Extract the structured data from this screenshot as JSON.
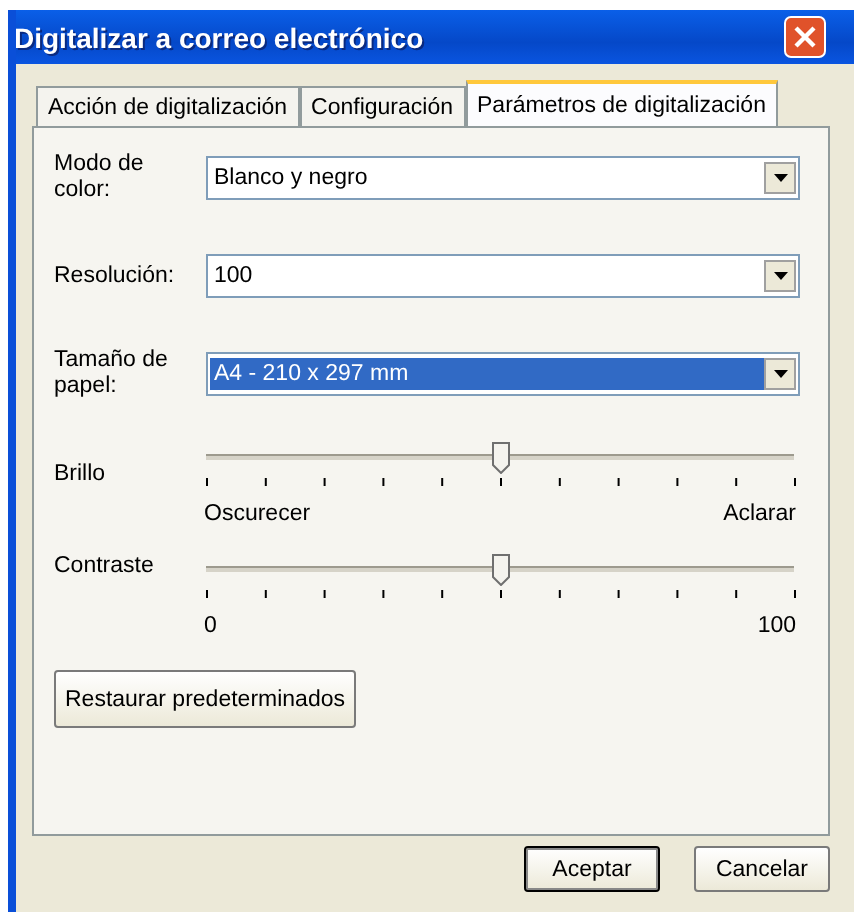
{
  "window": {
    "title": "Digitalizar a correo electrónico"
  },
  "tabs": [
    {
      "label": "Acción de digitalización",
      "selected": false
    },
    {
      "label": "Configuración",
      "selected": false
    },
    {
      "label": "Parámetros de digitalización",
      "selected": true
    }
  ],
  "fields": [
    {
      "label": "Modo de color:",
      "value": "Blanco y negro",
      "focused": false
    },
    {
      "label": "Resolución:",
      "value": "100",
      "focused": false
    },
    {
      "label": "Tamaño de papel:",
      "value": "A4 - 210 x 297 mm",
      "focused": true
    }
  ],
  "sliders": [
    {
      "label": "Brillo",
      "level": 0.5,
      "min_label": "Oscurecer",
      "max_label": "Aclarar"
    },
    {
      "label": "Contraste",
      "level": 0.5,
      "min_label": "0",
      "max_label": "100"
    }
  ],
  "restore_button": "Restaurar predeterminados",
  "buttons": [
    {
      "label": "Aceptar",
      "default": true
    },
    {
      "label": "Cancelar",
      "default": false
    }
  ]
}
